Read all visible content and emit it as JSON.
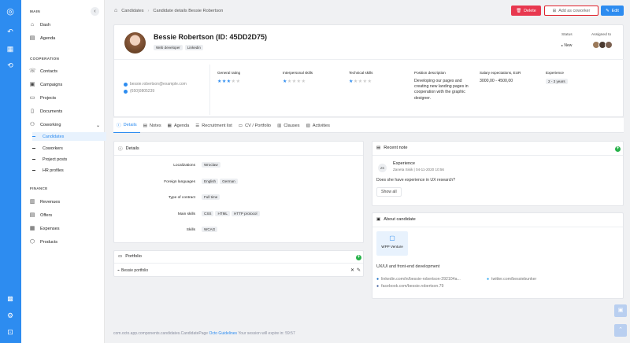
{
  "sidebar": {
    "main_heading": "MAIN",
    "main_items": [
      {
        "label": "Dash",
        "icon": "home-icon"
      },
      {
        "label": "Agenda",
        "icon": "calendar-icon"
      }
    ],
    "coop_heading": "COOPERATION",
    "coop_items": [
      {
        "label": "Contacts",
        "icon": "contacts-icon"
      },
      {
        "label": "Campaigns",
        "icon": "campaigns-icon"
      },
      {
        "label": "Projects",
        "icon": "projects-icon"
      },
      {
        "label": "Documents",
        "icon": "documents-icon"
      },
      {
        "label": "Coworking",
        "icon": "coworking-icon"
      }
    ],
    "coworking_sub": [
      {
        "label": "Candidates",
        "active": true
      },
      {
        "label": "Coworkers"
      },
      {
        "label": "Project posts"
      },
      {
        "label": "HR profiles"
      }
    ],
    "finance_heading": "FINANCE",
    "finance_items": [
      {
        "label": "Revenues",
        "icon": "revenues-icon"
      },
      {
        "label": "Offers",
        "icon": "offers-icon"
      },
      {
        "label": "Expenses",
        "icon": "expenses-icon"
      },
      {
        "label": "Products",
        "icon": "products-icon"
      }
    ]
  },
  "breadcrumb": {
    "root": "Candidates",
    "current": "Candidate details Bessie Robertson"
  },
  "actions": {
    "delete": "Delete",
    "add_coworker": "Add as coworker",
    "edit": "Edit"
  },
  "profile": {
    "name": "Bessie Robertson (ID: 45DD2D75)",
    "tags": [
      "Web developer",
      "Linkedin"
    ],
    "status_label": "Status",
    "status_value": "New",
    "assigned_label": "Assigned to",
    "email": "bessie.robertson@example.com",
    "phone": "(650)0805239",
    "general_rating_label": "General rating",
    "general_rating": 3,
    "interpersonal_label": "Interpersonal skills",
    "interpersonal": 1,
    "technical_label": "Technical skills",
    "technical": 1,
    "position_label": "Position description",
    "position_text": "Developing our pages and creating new landing pages in cooperation with the graphic designer.",
    "salary_label": "Salary expectations, EUR",
    "salary_value": "3000,00 - 4500,00",
    "experience_label": "Experience",
    "experience_value": "2 - 3 years"
  },
  "tabs": [
    {
      "label": "Details",
      "icon": "info-icon"
    },
    {
      "label": "Notes",
      "icon": "notes-icon"
    },
    {
      "label": "Agenda",
      "icon": "calendar-icon"
    },
    {
      "label": "Recruitment list",
      "icon": "list-icon"
    },
    {
      "label": "CV / Portfolio",
      "icon": "folder-icon"
    },
    {
      "label": "Clauses",
      "icon": "clauses-icon"
    },
    {
      "label": "Activities",
      "icon": "activities-icon"
    }
  ],
  "details": {
    "title": "Details",
    "rows": [
      {
        "label": "Localizations",
        "values": [
          "Wroclaw"
        ]
      },
      {
        "label": "Foreign languages",
        "values": [
          "English",
          "German"
        ]
      },
      {
        "label": "Type of contract",
        "values": [
          "Full time"
        ]
      },
      {
        "label": "Main skills",
        "values": [
          "CSS",
          "HTML",
          "HTTP protocol"
        ]
      },
      {
        "label": "Skills",
        "values": [
          "WCAG"
        ]
      }
    ]
  },
  "portfolio": {
    "title": "Portfolio",
    "item": "Bessie portfolio"
  },
  "recent_note": {
    "title": "Recent note",
    "avatar": "ZS",
    "heading": "Experience",
    "meta": "Zaneta Sisik | 04-11-2020 10:56",
    "text": "Does she have experience in UX research?",
    "show_all": "Show all"
  },
  "about": {
    "title": "About candidate",
    "company": "WPP Venture",
    "text": "UX/UI and front-end development",
    "linkedin": "linkedin.com/in/bessie-robertson-292104a...",
    "twitter": "twitter.com/bessiebunker",
    "facebook": "facebook.com/bessie.robertson.79"
  },
  "footer": {
    "prefix": "com.octo.app.components.candidates.CandidatePage",
    "link": "Octo Guidelines",
    "suffix": "Your session will expire in: 59:57"
  },
  "colors": {
    "primary": "#2d8cf0",
    "danger": "#e8384f",
    "success": "#27b24a"
  }
}
